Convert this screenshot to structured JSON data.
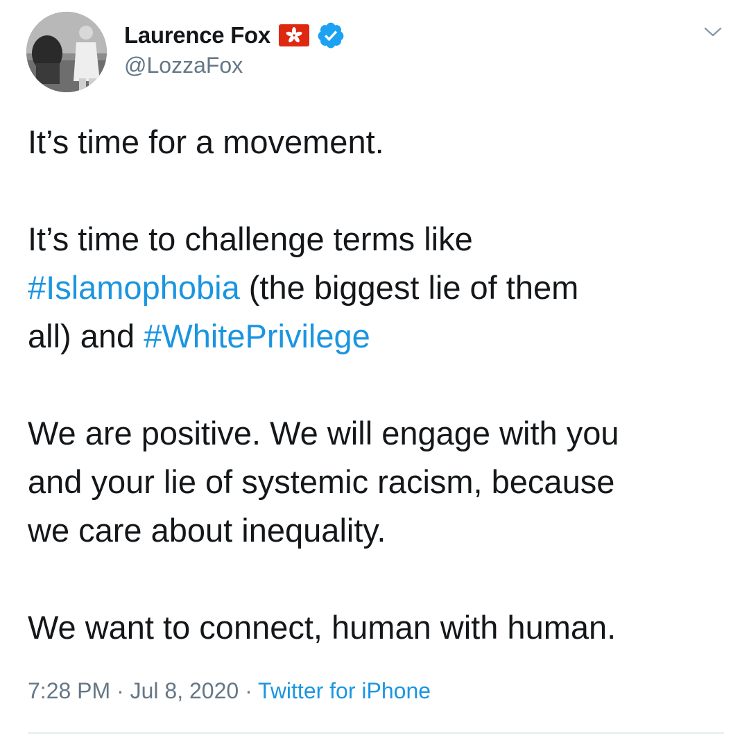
{
  "author": {
    "display_name": "Laurence Fox",
    "handle": "@LozzaFox",
    "badges": [
      "hong-kong-flag-icon",
      "verified-badge-icon"
    ]
  },
  "tweet": {
    "para1": "It’s time for a movement.",
    "para2": {
      "line1": "It’s time to challenge terms like",
      "hashtag1": "#Islamophobia",
      "line2_rest": " (the biggest lie of them",
      "line3_start": "all) and ",
      "hashtag2": "#WhitePrivilege"
    },
    "para3": {
      "line1": "We are positive. We will engage with you",
      "line2": "and your lie of systemic racism, because",
      "line3": "we care about inequality."
    },
    "para4": "We want to connect, human with human."
  },
  "meta": {
    "time": "7:28 PM",
    "separator": " · ",
    "date": "Jul 8, 2020",
    "source": "Twitter for iPhone"
  },
  "colors": {
    "text": "#14171a",
    "secondary": "#657786",
    "link": "#1b95e0",
    "verified": "#1da1f2",
    "flag_red": "#de2910",
    "divider": "#e6ecf0"
  }
}
